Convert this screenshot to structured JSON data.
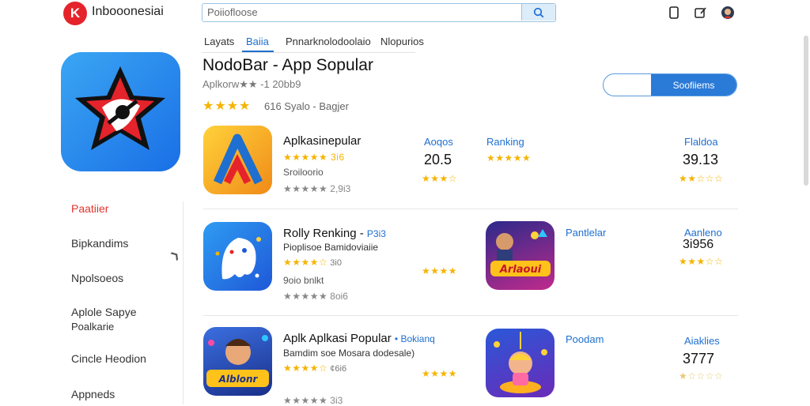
{
  "header": {
    "logo_letter": "K",
    "brand": "Inbooonesiai",
    "search_value": "Poiiofloose",
    "icons": [
      "search-icon",
      "phone-icon",
      "edit-icon",
      "profile-avatar"
    ]
  },
  "tabs": [
    {
      "label": "Layats"
    },
    {
      "label": "Baiia"
    },
    {
      "label": "Pnnarknolodoolaio"
    },
    {
      "label": "Nlopurios"
    }
  ],
  "hero": {
    "title": "NodoBar - App Sopular",
    "subtitle": "Aplkorw★★ -1 20bb9",
    "stars": "★★★★",
    "meta": "616   Syalo  -   Bagjer",
    "install_label": "Soofiiems"
  },
  "sidebar": {
    "items": [
      {
        "label": "Paatiier"
      },
      {
        "label": "Bipkandims"
      },
      {
        "label": "Npolsoeos"
      },
      {
        "label": "Aplole Sapye"
      },
      {
        "label": "Poalkarie"
      },
      {
        "label": "Cincle Heodion"
      },
      {
        "label": "Appneds"
      }
    ]
  },
  "apps": [
    {
      "name": "Aplkasinepular",
      "tag": "",
      "desc": "★★★★★ 3i6",
      "sub": "Sroiloorio",
      "rating_count": "2,9i3",
      "col1_label": "Aoqos",
      "col1_value": "20.5",
      "col2_label": "Ranking",
      "col2_stars": "★★★★★",
      "col3_label": "Flaldoa",
      "col3_value": "39.13"
    },
    {
      "name": "Rolly Renking -",
      "tag": "P3i3",
      "desc": "Pioplisoe Bamidoviaiie",
      "sub": "9oio bnlkt",
      "rating_count": "8oi6",
      "star_count": "3i0",
      "col2_label": "Pantlelar",
      "col3_label": "Aanleno",
      "col3_value": "3i956"
    },
    {
      "name": "Aplk Aplkasi Popular",
      "tag": "• Bokianq",
      "desc": "Bamdim soe Mosara dodesale)",
      "sub": "",
      "rating_count": "3i3",
      "star_count": "¢6i6",
      "col2_label": "Poodam",
      "col3_label": "Aiaklies",
      "col3_value": "3777"
    }
  ],
  "colors": {
    "accent": "#1e6fcf",
    "star": "#f5b400",
    "red": "#e0342c"
  }
}
